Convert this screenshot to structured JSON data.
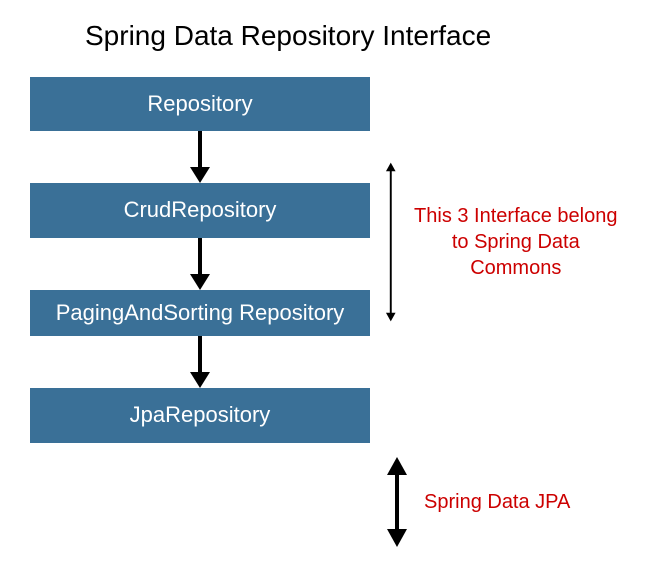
{
  "title": "Spring Data Repository Interface",
  "boxes": [
    {
      "label": "Repository"
    },
    {
      "label": "CrudRepository"
    },
    {
      "label": "PagingAndSorting Repository"
    },
    {
      "label": "JpaRepository"
    }
  ],
  "annotations": {
    "top": "This 3 Interface belong to Spring Data Commons",
    "bottom": "Spring Data JPA"
  },
  "colors": {
    "box_bg": "#3a7097",
    "annotation_text": "#cc0000"
  }
}
